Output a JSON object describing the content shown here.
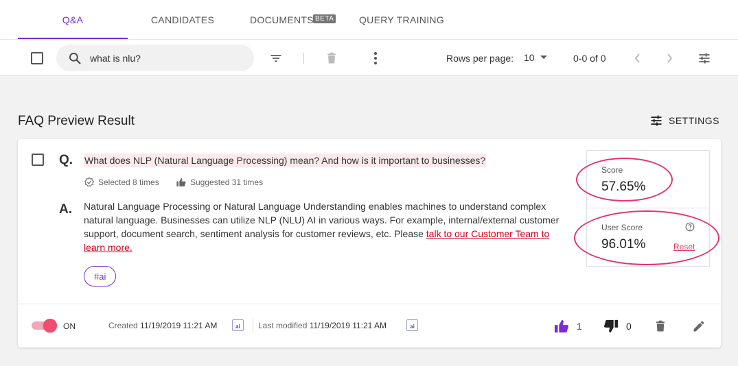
{
  "tabs": [
    {
      "label": "Q&A",
      "active": true
    },
    {
      "label": "CANDIDATES",
      "active": false
    },
    {
      "label": "DOCUMENTS",
      "active": false
    },
    {
      "label": "QUERY TRAINING",
      "active": false
    }
  ],
  "beta_badge": "BETA",
  "toolbar": {
    "search_value": "what is nlu?",
    "rows_per_page_label": "Rows per page:",
    "rows_per_page_value": "10",
    "range_text": "0-0 of 0"
  },
  "section": {
    "title": "FAQ Preview Result",
    "settings_label": "SETTINGS"
  },
  "card": {
    "q_letter": "Q.",
    "a_letter": "A.",
    "question": "What does NLP (Natural Language Processing) mean? And how is it important to businesses?",
    "selected_text": "Selected 8 times",
    "suggested_text": "Suggested 31 times",
    "answer_text": "Natural Language Processing or Natural Language Understanding enables machines to understand complex natural language. Businesses can utilize NLP (NLU) AI in various ways. For example, internal/external customer support, document search, sentiment analysis for customer reviews, etc. Please ",
    "answer_link": "talk to our Customer Team to learn more.",
    "tag": "#ai",
    "score_label": "Score",
    "score_value": "57.65%",
    "user_score_label": "User Score",
    "user_score_value": "96.01%",
    "reset_label": "Reset",
    "toggle_label": "ON",
    "toggle_on": true,
    "created_label": "Created",
    "created_date": "11/19/2019 11:21 AM",
    "modified_label": "Last modified",
    "modified_date": "11/19/2019 11:21 AM",
    "ai_badge": "ai",
    "likes": "1",
    "dislikes": "0"
  },
  "colors": {
    "accent": "#7b2ad6",
    "highlight": "#e6336c",
    "link": "#d0021b"
  }
}
